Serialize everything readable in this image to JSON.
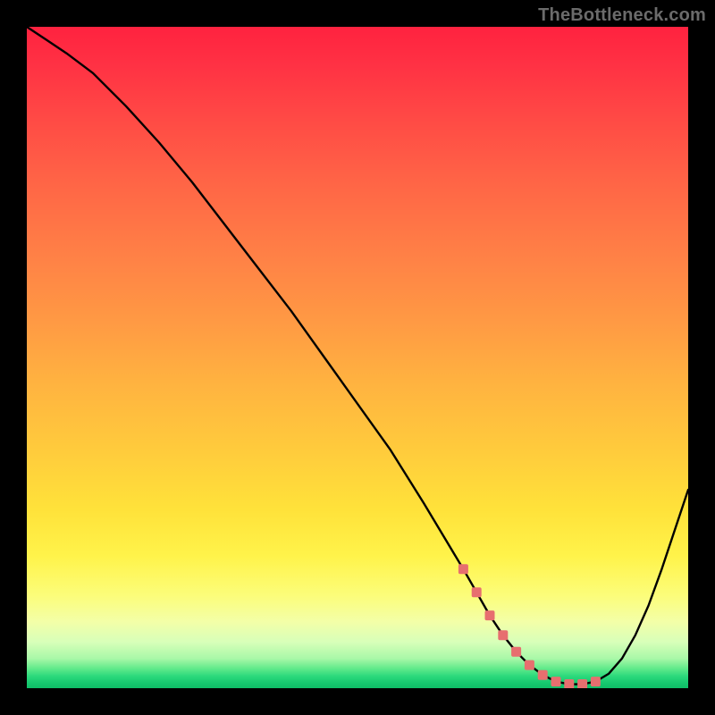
{
  "watermark": "TheBottleneck.com",
  "colors": {
    "marker": "#e76f6f",
    "curve": "#000000",
    "frame_bg": "#000000"
  },
  "chart_data": {
    "type": "line",
    "title": "",
    "xlabel": "",
    "ylabel": "",
    "xlim": [
      0,
      100
    ],
    "ylim": [
      0,
      100
    ],
    "grid": false,
    "legend": false,
    "series": [
      {
        "name": "bottleneck-curve",
        "x": [
          0,
          3,
          6,
          10,
          15,
          20,
          25,
          30,
          35,
          40,
          45,
          50,
          55,
          60,
          63,
          66,
          68,
          70,
          72,
          74,
          76,
          78,
          80,
          82,
          84,
          86,
          88,
          90,
          92,
          94,
          96,
          98,
          100
        ],
        "y": [
          100,
          98,
          96,
          93,
          88,
          82.5,
          76.5,
          70,
          63.5,
          57,
          50,
          43,
          36,
          28,
          23,
          18,
          14.5,
          11,
          8,
          5.5,
          3.5,
          2,
          1,
          0.6,
          0.6,
          1,
          2.2,
          4.5,
          8,
          12.5,
          18,
          24,
          30
        ]
      }
    ],
    "markers": {
      "name": "optimal-zone",
      "x": [
        66,
        68,
        70,
        72,
        74,
        76,
        78,
        80,
        82,
        84,
        86
      ],
      "y": [
        18,
        14.5,
        11,
        8,
        5.5,
        3.5,
        2,
        1,
        0.6,
        0.6,
        1
      ]
    }
  }
}
